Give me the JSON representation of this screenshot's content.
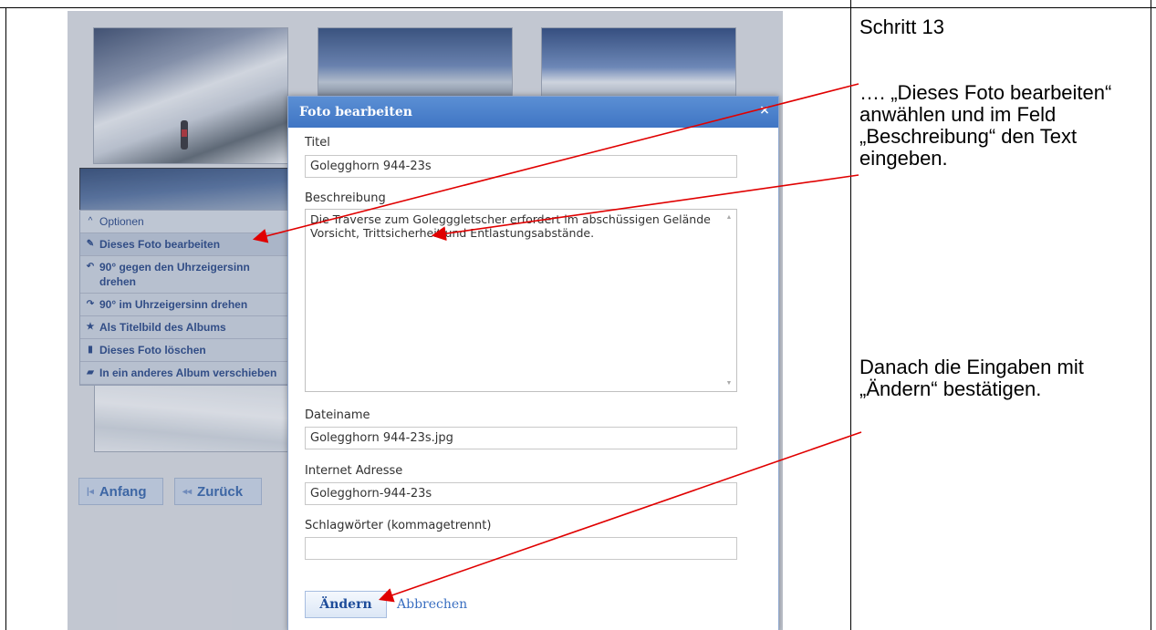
{
  "dialog": {
    "title": "Foto bearbeiten",
    "close_glyph": "×",
    "fields": {
      "title_label": "Titel",
      "title_value": "Golegghorn 944-23s",
      "description_label": "Beschreibung",
      "description_value": "Die Traverse zum Golegggletscher erfordert im abschüssigen Gelände Vorsicht, Trittsicherheit und Entlastungsabstände.",
      "filename_label": "Dateiname",
      "filename_value": "Golegghorn 944-23s.jpg",
      "url_label": "Internet Adresse",
      "url_value": "Golegghorn-944-23s",
      "tags_label": "Schlagwörter (kommagetrennt)",
      "tags_value": ""
    },
    "submit_label": "Ändern",
    "cancel_label": "Abbrechen"
  },
  "context_menu": {
    "items": [
      {
        "icon": "chevron-up-icon",
        "glyph": "^",
        "label": "Optionen"
      },
      {
        "icon": "pencil-icon",
        "glyph": "✎",
        "label": "Dieses Foto bearbeiten"
      },
      {
        "icon": "rotate-left-icon",
        "glyph": "↶",
        "label": "90° gegen den Uhrzeigersinn drehen"
      },
      {
        "icon": "rotate-right-icon",
        "glyph": "↷",
        "label": "90° im Uhrzeigersinn drehen"
      },
      {
        "icon": "star-icon",
        "glyph": "★",
        "label": "Als Titelbild des Albums"
      },
      {
        "icon": "trash-icon",
        "glyph": "▮",
        "label": "Dieses Foto löschen"
      },
      {
        "icon": "folder-icon",
        "glyph": "▰",
        "label": "In ein anderes Album verschieben"
      }
    ]
  },
  "pager": {
    "start_label": "Anfang",
    "back_label": "Zurück",
    "start_glyph": "|◂",
    "back_glyph": "◂◂"
  },
  "instructions": {
    "step": "Schritt 13",
    "part1": "…. „Dieses Foto bearbeiten“ anwählen und im Feld „Beschreibung“ den Text eingeben.",
    "part2": "Danach die Eingaben mit „Ändern“ bestätigen."
  },
  "colors": {
    "annotation_arrow": "#e00000",
    "dialog_header": "#4a80cc",
    "link": "#3a6fc1"
  }
}
